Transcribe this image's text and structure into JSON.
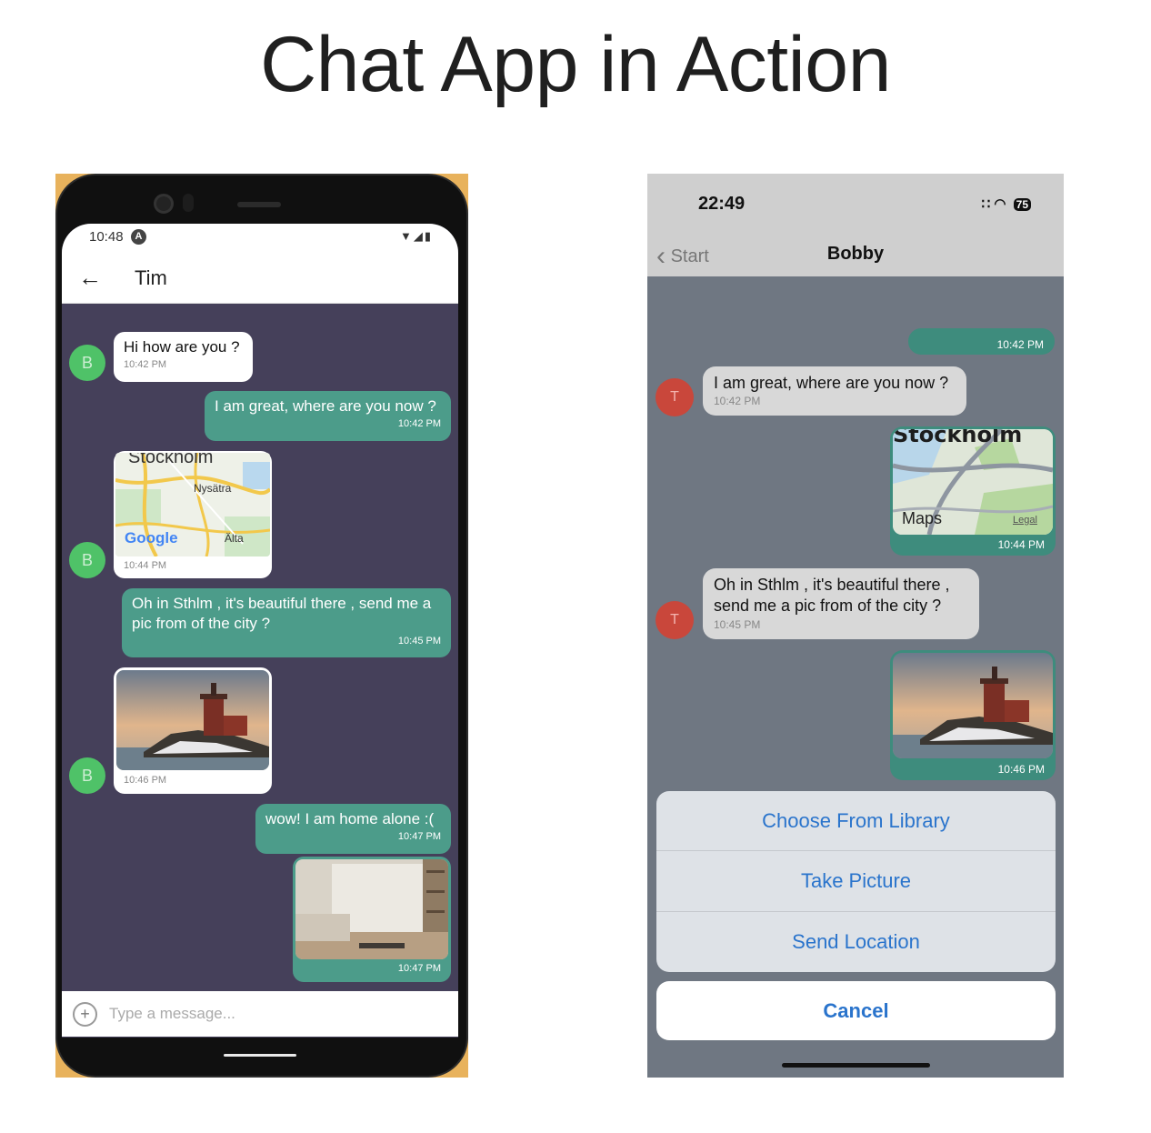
{
  "page_title": "Chat App in Action",
  "android": {
    "status_time": "10:48",
    "status_app_icon": "A",
    "status_icons": "▼◢▮",
    "back_icon": "←",
    "contact_name": "Tim",
    "avatar_letter": "B",
    "messages": [
      {
        "text": "Hi how are you ?",
        "time": "10:42 PM",
        "side": "left"
      },
      {
        "text": "I am great, where are you now ?",
        "time": "10:42 PM",
        "side": "right"
      },
      {
        "map_title": "Stockholm",
        "map_place1": "Nysätra",
        "map_place2": "Älta",
        "map_brand": "Google",
        "time": "10:44 PM",
        "side": "left"
      },
      {
        "text": "Oh in Sthlm , it's beautiful there , send me a pic from of the city ?",
        "time": "10:45 PM",
        "side": "right"
      },
      {
        "time": "10:46 PM",
        "side": "left",
        "image": "castle-photo"
      },
      {
        "text": "wow! I am home alone :(",
        "time": "10:47 PM",
        "side": "right"
      },
      {
        "time": "10:47 PM",
        "side": "right",
        "image": "living-room-photo"
      }
    ],
    "input_placeholder": "Type a message...",
    "plus_icon": "+"
  },
  "iphone": {
    "status_time": "22:49",
    "status_icons": "∷ ◠",
    "battery": "75",
    "back_label": "Start",
    "back_chevron": "‹",
    "contact_name": "Bobby",
    "avatar_letter": "T",
    "messages": [
      {
        "time": "10:42 PM",
        "side": "right"
      },
      {
        "text": "I am great, where are you now ?",
        "time": "10:42 PM",
        "side": "left"
      },
      {
        "map_title": "Stockholm",
        "map_brand": "Maps",
        "map_legal": "Legal",
        "time": "10:44 PM",
        "side": "right"
      },
      {
        "text": "Oh in Sthlm , it's beautiful there , send me a pic from of the city ?",
        "time": "10:45 PM",
        "side": "left"
      },
      {
        "time": "10:46 PM",
        "side": "right",
        "image": "castle-photo"
      }
    ],
    "action_sheet": [
      "Choose From Library",
      "Take Picture",
      "Send Location"
    ],
    "cancel_label": "Cancel"
  },
  "colors": {
    "android_chat_bg": "#45405a",
    "android_sent_bubble": "#4c9c8a",
    "android_avatar": "#4fc268",
    "ios_chat_bg": "#6f7782",
    "ios_sent_bubble": "#3e8c7d",
    "ios_avatar": "#c9473b",
    "ios_action_blue": "#2a74cc"
  }
}
